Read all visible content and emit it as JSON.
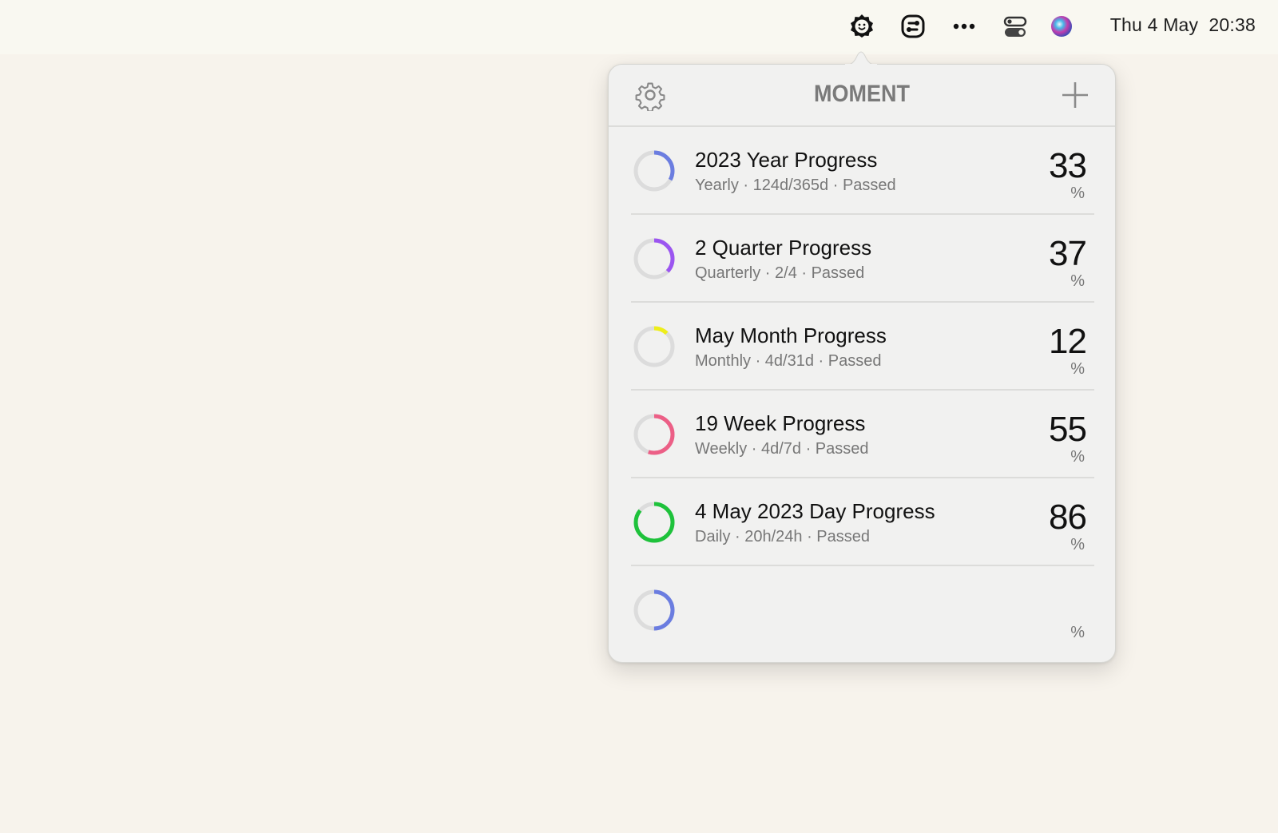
{
  "menubar": {
    "icons": [
      "moment-app-icon",
      "shortcuts-icon",
      "more-icon",
      "control-center-icon",
      "siri-icon"
    ],
    "clock": "Thu 4 May  20:38"
  },
  "popover": {
    "app_name": "MOMENT",
    "settings_icon": "gear-icon",
    "add_icon": "plus-icon",
    "items": [
      {
        "title": "2023 Year Progress",
        "subtitle": "Yearly · 124d/365d · Passed",
        "percent": "33",
        "unit": "%",
        "progress": 0.33,
        "color": "#6b7de0"
      },
      {
        "title": "2 Quarter Progress",
        "subtitle": "Quarterly · 2/4 · Passed",
        "percent": "37",
        "unit": "%",
        "progress": 0.37,
        "color": "#9b55f0"
      },
      {
        "title": "May Month Progress",
        "subtitle": "Monthly · 4d/31d · Passed",
        "percent": "12",
        "unit": "%",
        "progress": 0.12,
        "color": "#eeee1a"
      },
      {
        "title": "19 Week Progress",
        "subtitle": "Weekly · 4d/7d · Passed",
        "percent": "55",
        "unit": "%",
        "progress": 0.55,
        "color": "#ec5f86"
      },
      {
        "title": "4 May 2023 Day Progress",
        "subtitle": "Daily · 20h/24h · Passed",
        "percent": "86",
        "unit": "%",
        "progress": 0.86,
        "color": "#1ec23b"
      },
      {
        "title": "",
        "subtitle": "",
        "percent": "",
        "unit": "%",
        "progress": 0.5,
        "color": "#6b7de0"
      }
    ]
  }
}
